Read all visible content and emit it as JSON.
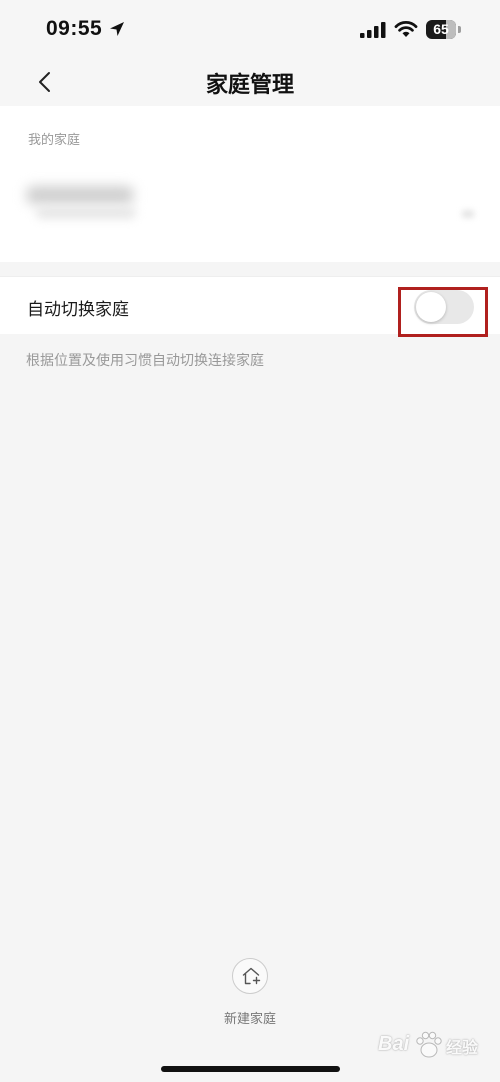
{
  "status_bar": {
    "time": "09:55",
    "battery_level": "65",
    "icons": [
      "location-arrow-icon",
      "cellular-signal-icon",
      "wifi-icon",
      "battery-icon"
    ]
  },
  "nav": {
    "title": "家庭管理",
    "back_icon": "chevron-left-icon"
  },
  "homes_section": {
    "label": "我的家庭"
  },
  "auto_switch": {
    "label": "自动切换家庭",
    "enabled": false,
    "hint": "根据位置及使用习惯自动切换连接家庭",
    "highlight_color": "#b0201e"
  },
  "new_home": {
    "label": "新建家庭",
    "icon": "home-add-icon"
  },
  "watermark": {
    "text_en": "Bai",
    "text_cn": "经验"
  }
}
